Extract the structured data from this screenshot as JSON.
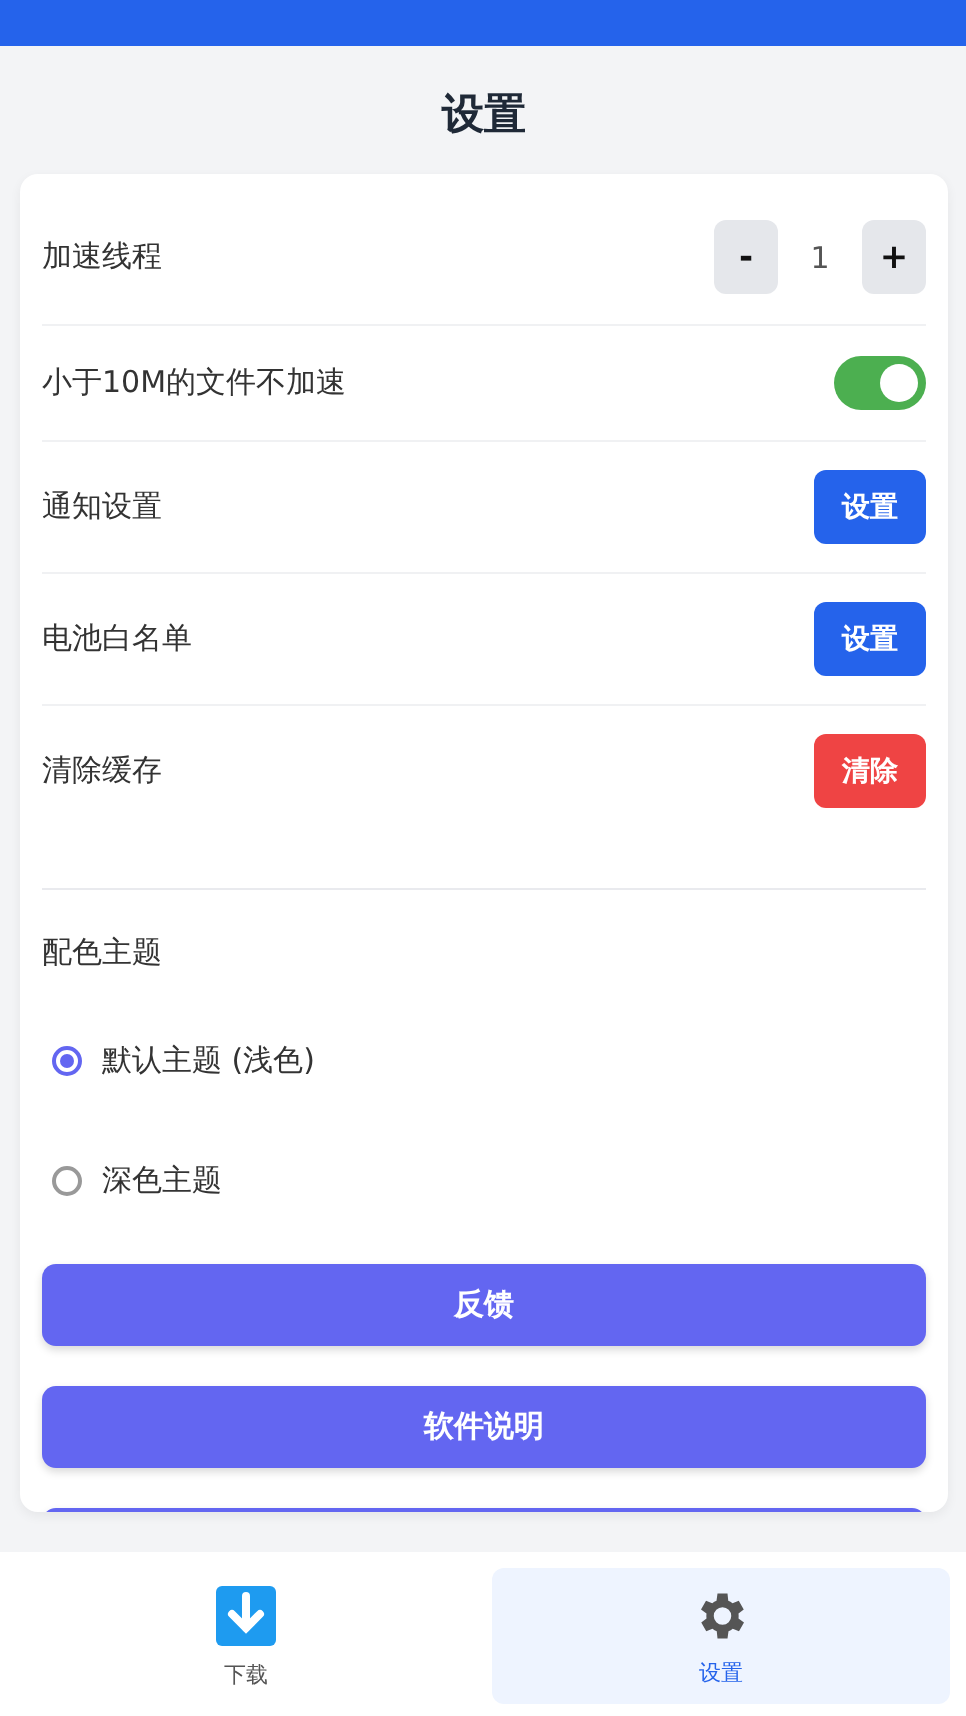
{
  "title": "设置",
  "settings": [
    {
      "kind": "stepper",
      "label": "加速线程",
      "value": "1",
      "minus": "-",
      "plus": "+"
    },
    {
      "kind": "toggle",
      "label": "小于10M的文件不加速",
      "on": true
    },
    {
      "kind": "button",
      "label": "通知设置",
      "button": "设置",
      "color": "#2563eb"
    },
    {
      "kind": "button",
      "label": "电池白名单",
      "button": "设置",
      "color": "#2563eb"
    },
    {
      "kind": "button",
      "label": "清除缓存",
      "button": "清除",
      "color": "#ef4444"
    }
  ],
  "theme": {
    "label": "配色主题",
    "options": [
      {
        "label": "默认主题 (浅色)",
        "selected": true
      },
      {
        "label": "深色主题",
        "selected": false
      }
    ]
  },
  "actions": [
    {
      "kind": "button",
      "label": "反馈"
    },
    {
      "kind": "button",
      "label": "软件说明"
    },
    {
      "kind": "cut_off"
    }
  ],
  "nav": [
    {
      "kind": "download",
      "label": "下载",
      "selected": false
    },
    {
      "kind": "gear",
      "label": "设置",
      "selected": true
    }
  ]
}
